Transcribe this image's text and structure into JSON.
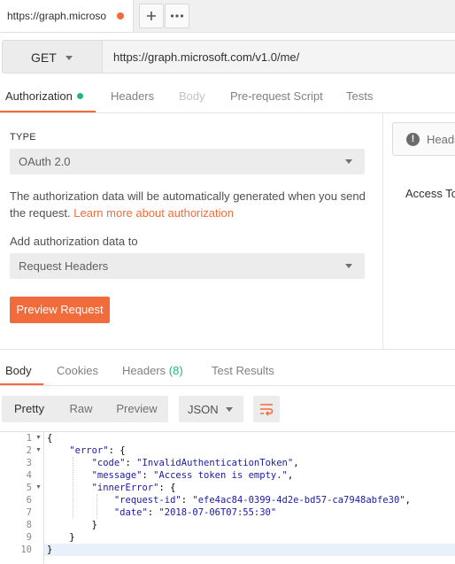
{
  "tab": {
    "title": "https://graph.microso",
    "add_icon": "plus-icon",
    "more_icon": "ellipsis-icon",
    "unsaved_color": "#f26b3a"
  },
  "request": {
    "method": "GET",
    "url": "https://graph.microsoft.com/v1.0/me/"
  },
  "request_tabs": [
    {
      "label": "Authorization",
      "active": true
    },
    {
      "label": "Headers"
    },
    {
      "label": "Body",
      "disabled": true
    },
    {
      "label": "Pre-request Script"
    },
    {
      "label": "Tests"
    }
  ],
  "auth": {
    "type_label": "TYPE",
    "type_value": "OAuth 2.0",
    "description": "The authorization data will be automatically generated when you send the request.",
    "learn_more": "Learn more about authorization",
    "add_to_label": "Add authorization data to",
    "add_to_value": "Request Headers",
    "preview_button": "Preview Request"
  },
  "right_panel": {
    "heads_text": "Heads",
    "access_text": "Access Tok"
  },
  "response_tabs": [
    {
      "label": "Body",
      "active": true
    },
    {
      "label": "Cookies"
    },
    {
      "label": "Headers",
      "count": "(8)"
    },
    {
      "label": "Test Results"
    }
  ],
  "view_buttons": [
    {
      "label": "Pretty",
      "active": true
    },
    {
      "label": "Raw"
    },
    {
      "label": "Preview"
    }
  ],
  "format": "JSON",
  "wrap_icon": "wrap-lines-icon",
  "code_lines": [
    {
      "n": "1",
      "fold": true
    },
    {
      "n": "2",
      "fold": true,
      "key": "\"error\""
    },
    {
      "n": "3",
      "key": "\"code\"",
      "value": "\"InvalidAuthenticationToken\""
    },
    {
      "n": "4",
      "key": "\"message\"",
      "value": "\"Access token is empty.\""
    },
    {
      "n": "5",
      "fold": true,
      "key": "\"innerError\""
    },
    {
      "n": "6",
      "key": "\"request-id\"",
      "value": "\"efe4ac84-0399-4d2e-bd57-ca7948abfe30\""
    },
    {
      "n": "7",
      "key": "\"date\"",
      "value": "\"2018-07-06T07:55:30\""
    },
    {
      "n": "8"
    },
    {
      "n": "9"
    },
    {
      "n": "10"
    }
  ],
  "colors": {
    "accent": "#f26b3a",
    "success": "#26b47f"
  }
}
